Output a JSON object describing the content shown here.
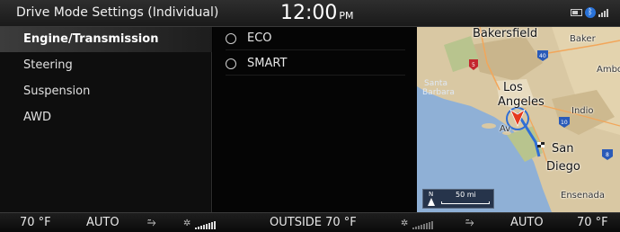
{
  "header": {
    "title": "Drive Mode Settings (Individual)",
    "time": "12:00",
    "ampm": "PM",
    "status_icons": [
      "battery-icon",
      "bluetooth-icon",
      "signal-icon"
    ]
  },
  "menu": {
    "items": [
      {
        "label": "Engine/Transmission",
        "active": true
      },
      {
        "label": "Steering",
        "active": false
      },
      {
        "label": "Suspension",
        "active": false
      },
      {
        "label": "AWD",
        "active": false
      }
    ]
  },
  "options": {
    "items": [
      {
        "label": "ECO",
        "selected": false
      },
      {
        "label": "SMART",
        "selected": false
      }
    ]
  },
  "map": {
    "labels": {
      "bakersfield": "Bakersfield",
      "baker": "Baker",
      "ambo": "Ambo",
      "santa": "Santa",
      "barbara": "Barbara",
      "los": "Los",
      "angeles": "Angeles",
      "indio": "Indio",
      "av": "Av",
      "san": "San",
      "diego": "Diego",
      "ensenada": "Ensenada"
    },
    "shields": [
      "5",
      "40",
      "10",
      "8"
    ],
    "scale": {
      "north": "N",
      "distance": "50 mi"
    },
    "colors": {
      "land": "#d9c8a3",
      "water": "#8fb0d6",
      "route": "#2f6fd6",
      "marker": "#e53a1f"
    }
  },
  "climate": {
    "left_temp": "70 °F",
    "left_mode": "AUTO",
    "outside": "OUTSIDE  70 °F",
    "right_mode": "AUTO",
    "right_temp": "70 °F",
    "fan_icon": "fan-icon",
    "airflow_icon": "airflow-icon"
  }
}
